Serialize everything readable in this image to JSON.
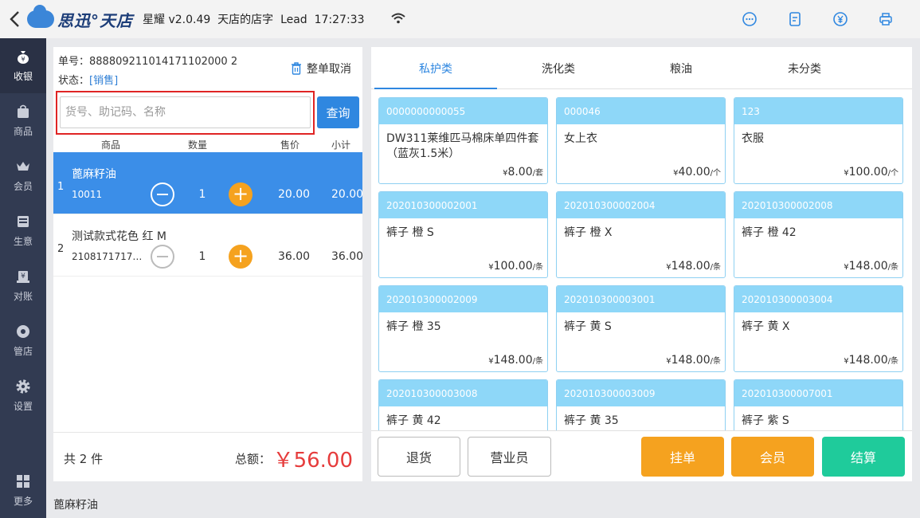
{
  "header": {
    "brand": "思迅°天店",
    "app_info": "星耀 v2.0.49  天店的店字  Lead  17:27:33"
  },
  "sidebar": {
    "items": [
      "收银",
      "商品",
      "会员",
      "生意",
      "对账",
      "管店",
      "设置"
    ],
    "more": "更多"
  },
  "order": {
    "number_label": "单号：",
    "number": "888809211014171102000 2",
    "status_label": "状态：",
    "status": "[销售]",
    "cancel_label": "整单取消"
  },
  "search": {
    "placeholder": "货号、助记码、名称",
    "button": "查询"
  },
  "table": {
    "headers": [
      "商品",
      "数量",
      "售价",
      "小计"
    ],
    "rows": [
      {
        "idx": "1",
        "name": "蓖麻籽油",
        "code": "10011",
        "qty": "1",
        "price": "20.00",
        "subtotal": "20.00"
      },
      {
        "idx": "2",
        "name": "测试款式花色 红 M",
        "code": "210817171743...",
        "qty": "1",
        "price": "36.00",
        "subtotal": "36.00"
      }
    ]
  },
  "summary": {
    "count": "共 2 件",
    "total_label": "总额：",
    "total": "￥56.00"
  },
  "categories": [
    "私护类",
    "洗化类",
    "粮油",
    "未分类"
  ],
  "products": [
    {
      "code": "0000000000055",
      "name": "DW311莱维匹马棉床单四件套（蓝灰1.5米）",
      "price": "8.00",
      "unit": "/套"
    },
    {
      "code": "000046",
      "name": "女上衣",
      "price": "40.00",
      "unit": "/个"
    },
    {
      "code": "123",
      "name": "衣服",
      "price": "100.00",
      "unit": "/个"
    },
    {
      "code": "202010300002001",
      "name": "裤子 橙 S",
      "price": "100.00",
      "unit": "/条"
    },
    {
      "code": "202010300002004",
      "name": "裤子 橙 X",
      "price": "148.00",
      "unit": "/条"
    },
    {
      "code": "202010300002008",
      "name": "裤子 橙 42",
      "price": "148.00",
      "unit": "/条"
    },
    {
      "code": "202010300002009",
      "name": "裤子 橙 35",
      "price": "148.00",
      "unit": "/条"
    },
    {
      "code": "202010300003001",
      "name": "裤子 黄 S",
      "price": "148.00",
      "unit": "/条"
    },
    {
      "code": "202010300003004",
      "name": "裤子 黄 X",
      "price": "148.00",
      "unit": "/条"
    },
    {
      "code": "202010300003008",
      "name": "裤子 黄 42",
      "price": "",
      "unit": ""
    },
    {
      "code": "202010300003009",
      "name": "裤子 黄 35",
      "price": "",
      "unit": ""
    },
    {
      "code": "202010300007001",
      "name": "裤子 紫 S",
      "price": "",
      "unit": ""
    }
  ],
  "buttons": {
    "return": "退货",
    "clerk": "营业员",
    "hold": "挂单",
    "member": "会员",
    "checkout": "结算"
  },
  "selected_item": "蓖麻籽油",
  "colors": {
    "accent": "#2f87e0",
    "orange": "#f5a21f",
    "green": "#1fcb9b",
    "sidebar": "#323b52",
    "total": "#e63c3c"
  }
}
